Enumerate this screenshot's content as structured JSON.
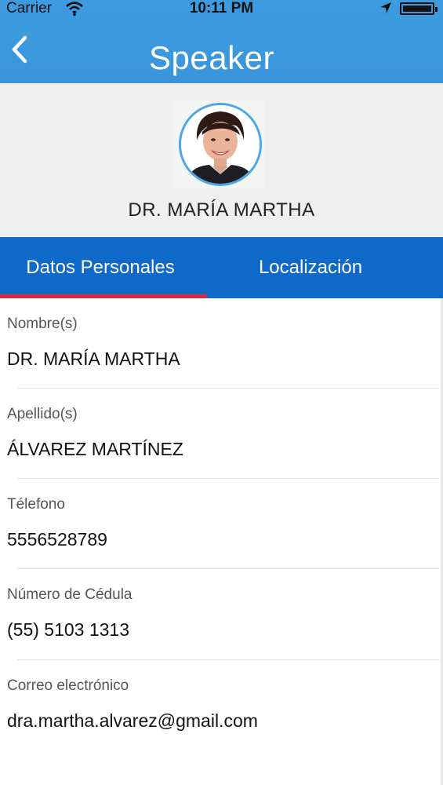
{
  "status": {
    "carrier": "Carrier",
    "time": "10:11 PM"
  },
  "header": {
    "title": "Speaker",
    "back_icon": "chevron-left-icon"
  },
  "profile": {
    "name": "DR. MARÍA MARTHA"
  },
  "tabs": [
    {
      "label": "Datos Personales",
      "active": true
    },
    {
      "label": "Localización",
      "active": false
    }
  ],
  "colors": {
    "header_blue": "#3d9be0",
    "tab_blue": "#0f69c9",
    "tab_indicator": "#d8283b",
    "avatar_ring": "#4aa8e6"
  },
  "fields": [
    {
      "label": "Nombre(s)",
      "value": "DR. MARÍA MARTHA"
    },
    {
      "label": "Apellido(s)",
      "value": "ÁLVAREZ MARTÍNEZ"
    },
    {
      "label": "Télefono",
      "value": "5556528789"
    },
    {
      "label": "Número de Cédula",
      "value": "(55) 5103 1313"
    },
    {
      "label": "Correo electrónico",
      "value": "dra.martha.alvarez@gmail.com"
    }
  ]
}
